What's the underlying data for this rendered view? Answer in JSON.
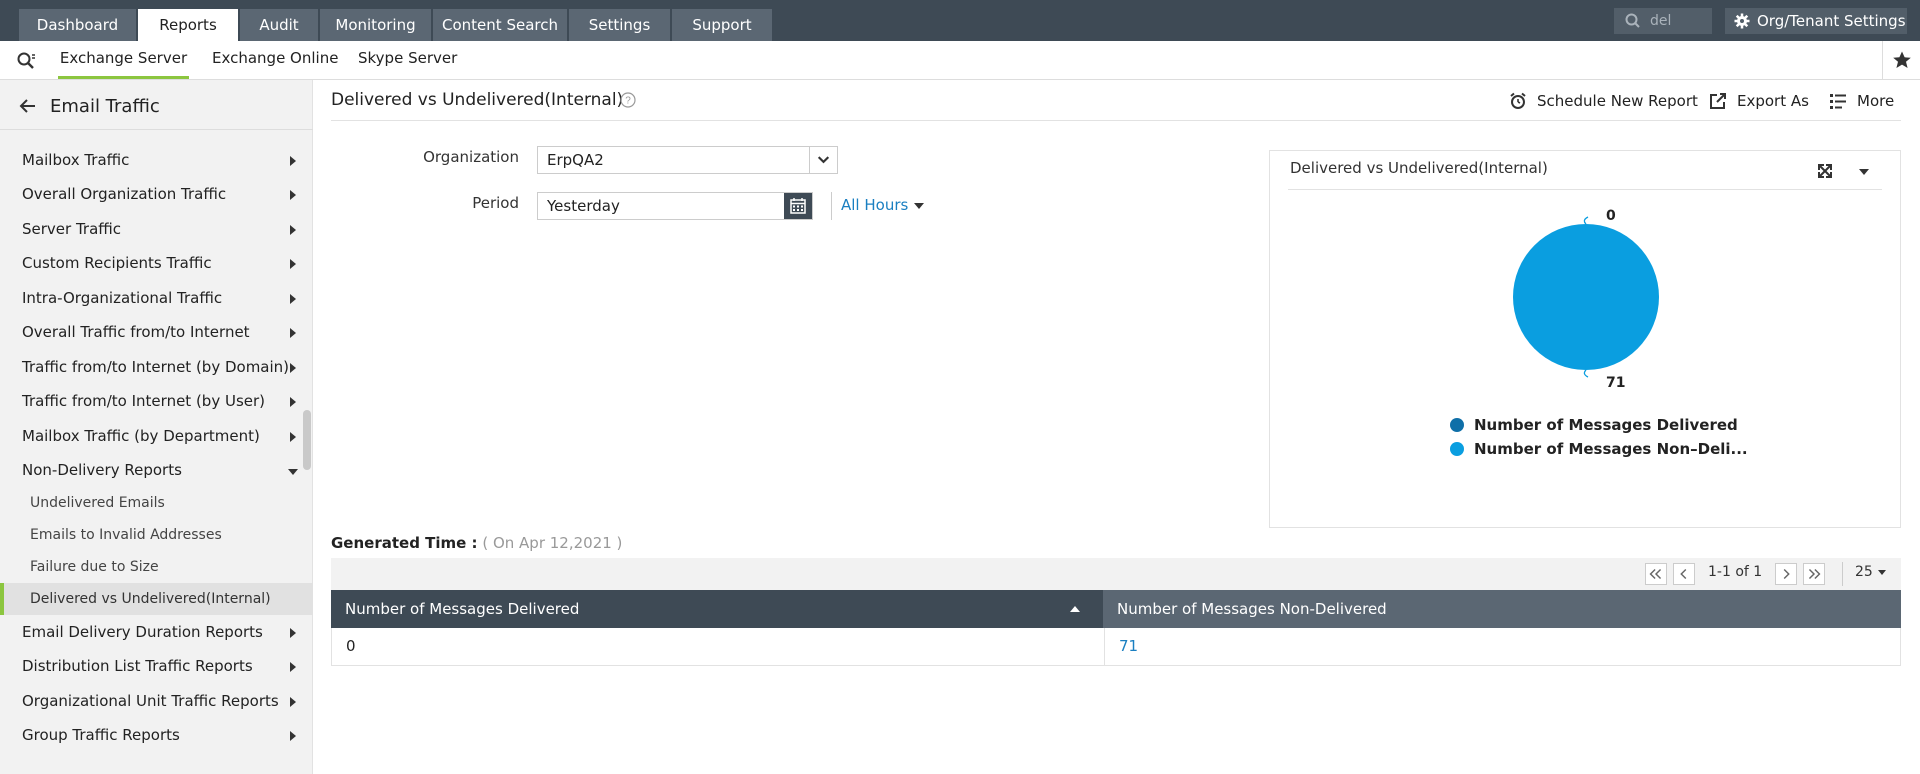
{
  "topnav": {
    "tabs": [
      {
        "label": "Dashboard"
      },
      {
        "label": "Reports"
      },
      {
        "label": "Audit"
      },
      {
        "label": "Monitoring"
      },
      {
        "label": "Content Search"
      },
      {
        "label": "Settings"
      },
      {
        "label": "Support"
      }
    ],
    "active_tab": "Reports",
    "search_value": "del",
    "org_settings_label": "Org/Tenant Settings"
  },
  "subnav": {
    "tabs": [
      {
        "label": "Exchange Server"
      },
      {
        "label": "Exchange Online"
      },
      {
        "label": "Skype Server"
      }
    ],
    "active_tab": "Exchange Server"
  },
  "sidebar": {
    "title": "Email Traffic",
    "items": [
      {
        "label": "Mailbox Traffic"
      },
      {
        "label": "Overall Organization Traffic"
      },
      {
        "label": "Server Traffic"
      },
      {
        "label": "Custom Recipients Traffic"
      },
      {
        "label": "Intra-Organizational Traffic"
      },
      {
        "label": "Overall Traffic from/to Internet"
      },
      {
        "label": "Traffic from/to Internet (by Domain)"
      },
      {
        "label": "Traffic from/to Internet (by User)"
      },
      {
        "label": "Mailbox Traffic (by Department)"
      },
      {
        "label": "Non-Delivery Reports"
      }
    ],
    "subitems": [
      {
        "label": "Undelivered Emails"
      },
      {
        "label": "Emails to Invalid Addresses"
      },
      {
        "label": "Failure due to Size"
      },
      {
        "label": "Delivered vs Undelivered(Internal)"
      }
    ],
    "items_after": [
      {
        "label": "Email Delivery Duration Reports"
      },
      {
        "label": "Distribution List Traffic Reports"
      },
      {
        "label": "Organizational Unit Traffic Reports"
      },
      {
        "label": "Group Traffic Reports"
      }
    ]
  },
  "main": {
    "title": "Delivered vs Undelivered(Internal)",
    "actions": {
      "schedule": "Schedule New Report",
      "export": "Export As",
      "more": "More"
    },
    "filters": {
      "organization_label": "Organization",
      "organization_value": "ErpQA2",
      "period_label": "Period",
      "period_value": "Yesterday",
      "hours_label": "All Hours"
    },
    "generated": {
      "label": "Generated Time :",
      "value": "( On Apr 12,2021 )"
    },
    "pager": {
      "info": "1-1 of 1",
      "page_size": "25"
    },
    "table": {
      "headers": [
        "Number of Messages Delivered",
        "Number of Messages Non-Delivered"
      ],
      "rows": [
        [
          "0",
          "71"
        ]
      ]
    }
  },
  "chart_data": {
    "type": "pie",
    "title": "Delivered vs Undelivered(Internal)",
    "categories": [
      "Number of Messages Delivered",
      "Number of Messages Non-Delivered"
    ],
    "values": [
      0,
      71
    ],
    "data_labels": [
      "0",
      "71"
    ],
    "legend_labels": [
      "Number of Messages Delivered",
      "Number of Messages Non–Deli..."
    ],
    "colors": [
      "#0f6fa8",
      "#0a9ee0"
    ],
    "legend_position": "bottom"
  }
}
